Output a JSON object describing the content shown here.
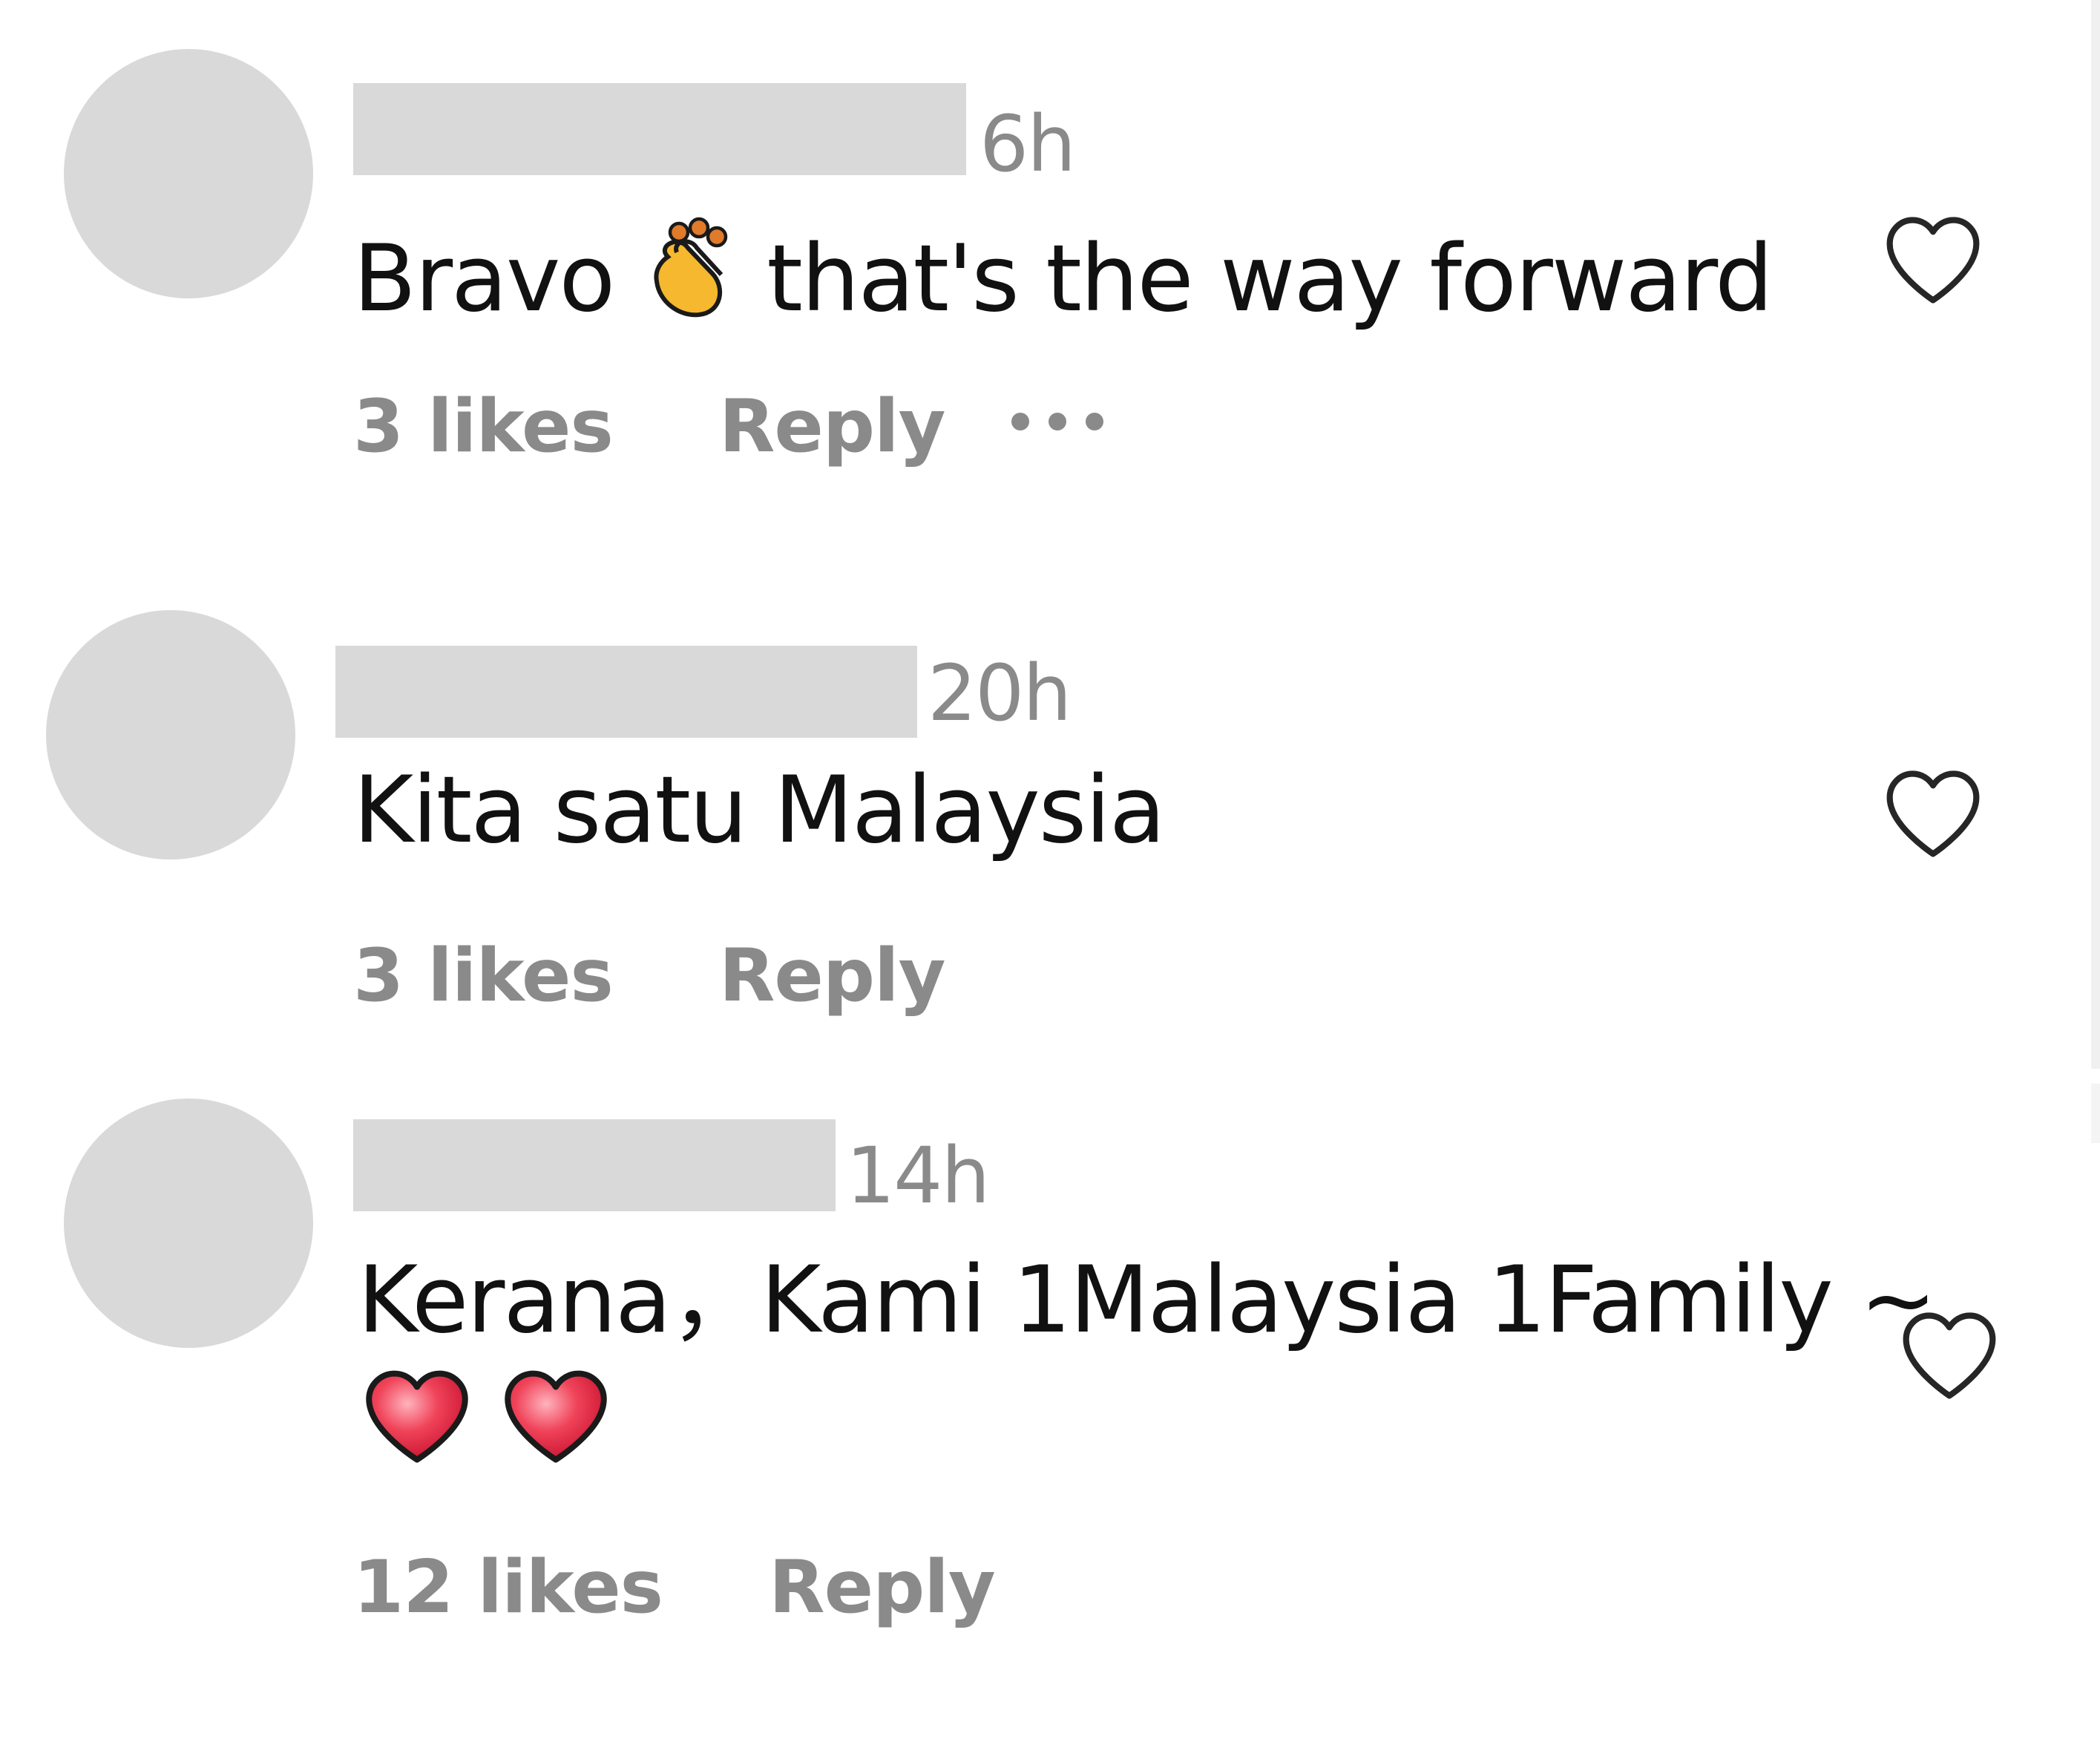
{
  "comments": [
    {
      "time": "6h",
      "text_before_emoji": "Bravo",
      "emoji": "clapping-hands",
      "text_after_emoji": "that's the way forward",
      "likes": "3 likes",
      "reply": "Reply",
      "more_icon": "ellipsis-icon",
      "like_icon": "heart-outline-icon"
    },
    {
      "time": "20h",
      "text": "Kita satu Malaysia",
      "likes": "3 likes",
      "reply": "Reply",
      "like_icon": "heart-outline-icon"
    },
    {
      "time": "14h",
      "text": "Kerana，Kami 1Malaysia 1Family ~",
      "emojis": [
        "red-heart",
        "red-heart"
      ],
      "likes": "12 likes",
      "reply": "Reply",
      "like_icon": "heart-outline-icon"
    }
  ],
  "colors": {
    "placeholder": "#d9d9d9",
    "meta_text": "#8a8a8a",
    "body_text": "#111111",
    "heart_stroke": "#262626",
    "emoji_heart": "#e0243a",
    "emoji_clap": "#f5b82e"
  }
}
